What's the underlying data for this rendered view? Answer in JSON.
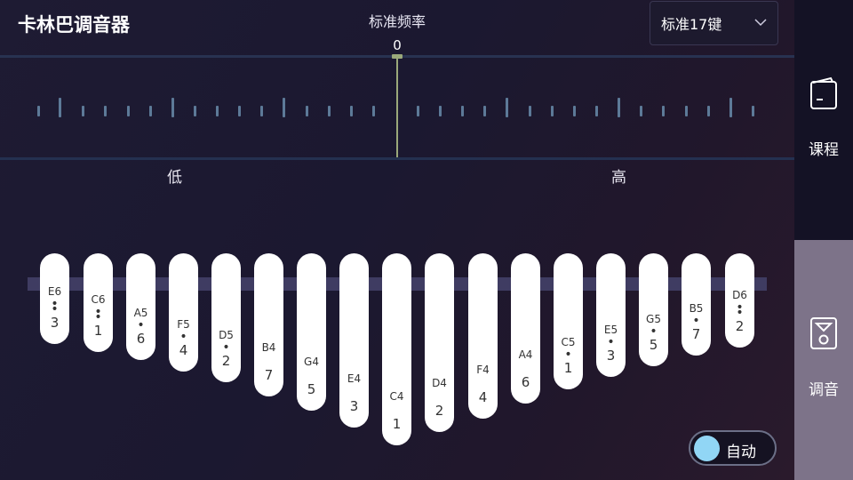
{
  "app": {
    "title": "卡林巴调音器"
  },
  "tuner": {
    "label": "标准频率",
    "value": "0",
    "low_label": "低",
    "high_label": "高"
  },
  "dropdown": {
    "selected": "标准17键",
    "icon": "chevron-down-icon"
  },
  "sidebar": {
    "items": [
      {
        "label": "课程",
        "icon": "book-icon",
        "active": false
      },
      {
        "label": "调音",
        "icon": "tuner-icon",
        "active": true
      }
    ]
  },
  "auto_toggle": {
    "label": "自动",
    "on": true
  },
  "tines": [
    {
      "note": "E6",
      "num": "3",
      "dots_above": 2
    },
    {
      "note": "C6",
      "num": "1",
      "dots_above": 2
    },
    {
      "note": "A5",
      "num": "6",
      "dots_above": 1
    },
    {
      "note": "F5",
      "num": "4",
      "dots_above": 1
    },
    {
      "note": "D5",
      "num": "2",
      "dots_above": 1
    },
    {
      "note": "B4",
      "num": "7",
      "dots_above": 0
    },
    {
      "note": "G4",
      "num": "5",
      "dots_above": 0
    },
    {
      "note": "E4",
      "num": "3",
      "dots_above": 0
    },
    {
      "note": "C4",
      "num": "1",
      "dots_above": 0
    },
    {
      "note": "D4",
      "num": "2",
      "dots_above": 0
    },
    {
      "note": "F4",
      "num": "4",
      "dots_above": 0
    },
    {
      "note": "A4",
      "num": "6",
      "dots_above": 0
    },
    {
      "note": "C5",
      "num": "1",
      "dots_above": 1
    },
    {
      "note": "E5",
      "num": "3",
      "dots_above": 1
    },
    {
      "note": "G5",
      "num": "5",
      "dots_above": 1
    },
    {
      "note": "B5",
      "num": "7",
      "dots_above": 1
    },
    {
      "note": "D6",
      "num": "2",
      "dots_above": 2
    }
  ],
  "colors": {
    "accent": "#91d6f5",
    "needle": "#9aa87a",
    "tick": "#5d7a98",
    "sidebar_active": "#7d7389"
  }
}
